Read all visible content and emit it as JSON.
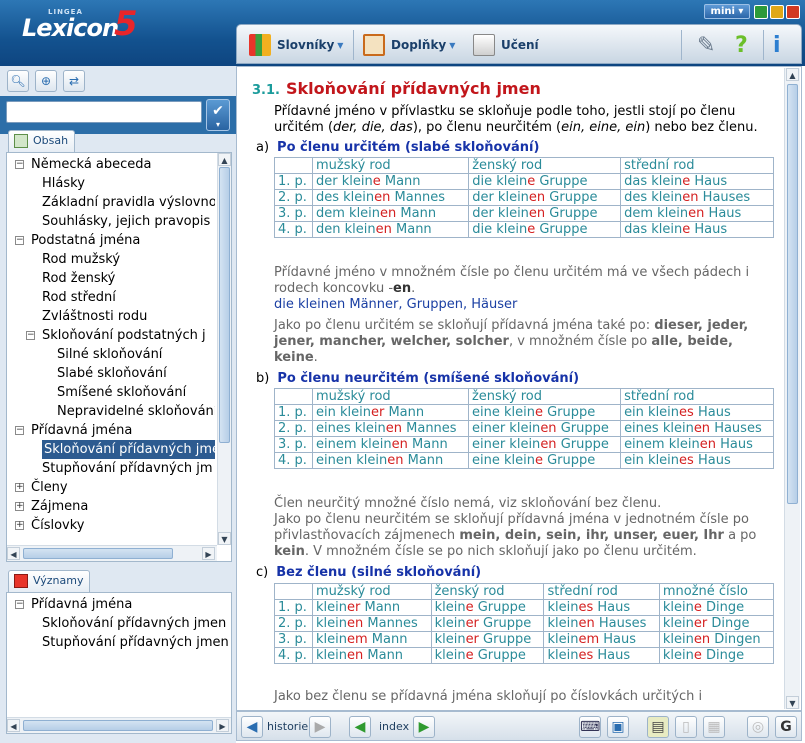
{
  "app": {
    "title": "Lexicon",
    "version": "5",
    "brand": "LINGEA"
  },
  "window": {
    "mini_label": "mini"
  },
  "menu": [
    {
      "label": "Slovníky"
    },
    {
      "label": "Doplňky"
    },
    {
      "label": "Učení"
    }
  ],
  "search": {
    "value": ""
  },
  "tabs": {
    "obsah": "Obsah",
    "vyznamy": "Významy"
  },
  "tree": [
    {
      "label": "Německá abeceda",
      "level": 0,
      "exp": "-"
    },
    {
      "label": "Hlásky",
      "level": 1
    },
    {
      "label": "Základní pravidla výslovno",
      "level": 1
    },
    {
      "label": "Souhlásky, jejich pravopis",
      "level": 1
    },
    {
      "label": "Podstatná jména",
      "level": 0,
      "exp": "-"
    },
    {
      "label": "Rod mužský",
      "level": 1
    },
    {
      "label": "Rod ženský",
      "level": 1
    },
    {
      "label": "Rod střední",
      "level": 1
    },
    {
      "label": "Zvláštnosti rodu",
      "level": 1
    },
    {
      "label": "Skloňování podstatných j",
      "level": 1,
      "exp": "-"
    },
    {
      "label": "Silné skloňování",
      "level": 2
    },
    {
      "label": "Slabé skloňování",
      "level": 2
    },
    {
      "label": "Smíšené skloňování",
      "level": 2
    },
    {
      "label": "Nepravidelné skloňování",
      "level": 2
    },
    {
      "label": "Přídavná jména",
      "level": 0,
      "exp": "-"
    },
    {
      "label": "Skloňování přídavných jme",
      "level": 1,
      "sel": true
    },
    {
      "label": "Stupňování přídavných jm",
      "level": 1
    },
    {
      "label": "Členy",
      "level": 0,
      "exp": "+"
    },
    {
      "label": "Zájmena",
      "level": 0,
      "exp": "+"
    },
    {
      "label": "Číslovky",
      "level": 0,
      "exp": "+"
    }
  ],
  "meanings": [
    {
      "label": "Přídavná jména",
      "level": 0,
      "exp": "-"
    },
    {
      "label": "Skloňování přídavných jmen",
      "level": 1
    },
    {
      "label": "Stupňování přídavných jmen",
      "level": 1
    }
  ],
  "article": {
    "num": "3.1.",
    "title": "Skloňování přídavných jmen",
    "intro": [
      "Přídavné jméno v přívlastku se skloňuje podle toho, jestli stojí po členu",
      "určitém (",
      "der, die, das",
      "), po členu neurčitém (",
      "ein, eine, ein",
      ") nebo bez členu."
    ],
    "sec_a": {
      "letter": "a)",
      "title": "Po členu určitém (slabé skloňování)"
    },
    "table_a": {
      "headers": [
        "mužský rod",
        "ženský rod",
        "střední rod"
      ],
      "rows": [
        [
          "1. p.",
          [
            "der klein",
            "e",
            " Mann"
          ],
          [
            "die klein",
            "e",
            " Gruppe"
          ],
          [
            "das klein",
            "e",
            " Haus"
          ]
        ],
        [
          "2. p.",
          [
            "des klein",
            "en",
            " Mannes"
          ],
          [
            "der klein",
            "en",
            " Gruppe"
          ],
          [
            "des klein",
            "en",
            " Hauses"
          ]
        ],
        [
          "3. p.",
          [
            "dem klein",
            "en",
            " Mann"
          ],
          [
            "der klein",
            "en",
            " Gruppe"
          ],
          [
            "dem klein",
            "en",
            " Haus"
          ]
        ],
        [
          "4. p.",
          [
            "den klein",
            "en",
            " Mann"
          ],
          [
            "die klein",
            "e",
            " Gruppe"
          ],
          [
            "das klein",
            "e",
            " Haus"
          ]
        ]
      ]
    },
    "plural_note": [
      "Přídavné jméno v množném čísle po členu určitém má ve všech pádech i",
      "rodech koncovku -",
      "en",
      "."
    ],
    "plural_ex": "die kleinen Männer, Gruppen, Häuser",
    "like_def": [
      "Jako po členu určitém se skloňují přídavná jména také po: ",
      "dieser, jeder,",
      "jener, mancher, welcher, solcher",
      ", v množném čísle po ",
      "alle, beide,",
      "keine",
      "."
    ],
    "sec_b": {
      "letter": "b)",
      "title": "Po členu neurčitém (smíšené skloňování)"
    },
    "table_b": {
      "headers": [
        "mužský rod",
        "ženský rod",
        "střední rod"
      ],
      "rows": [
        [
          "1. p.",
          [
            "ein klein",
            "er",
            " Mann"
          ],
          [
            "eine klein",
            "e",
            " Gruppe"
          ],
          [
            "ein klein",
            "es",
            " Haus"
          ]
        ],
        [
          "2. p.",
          [
            "eines klein",
            "en",
            " Mannes"
          ],
          [
            "einer klein",
            "en",
            " Gruppe"
          ],
          [
            "eines klein",
            "en",
            " Hauses"
          ]
        ],
        [
          "3. p.",
          [
            "einem klein",
            "en",
            " Mann"
          ],
          [
            "einer klein",
            "en",
            " Gruppe"
          ],
          [
            "einem klein",
            "en",
            " Haus"
          ]
        ],
        [
          "4. p.",
          [
            "einen klein",
            "en",
            " Mann"
          ],
          [
            "eine klein",
            "e",
            " Gruppe"
          ],
          [
            "ein klein",
            "es",
            " Haus"
          ]
        ]
      ]
    },
    "indef_note1": "Člen neurčitý množné číslo nemá, viz skloňování bez členu.",
    "indef_note2": [
      "Jako po členu neurčitém se skloňují přídavná jména v jednotném čísle po",
      "přivlastňovacích zájmenech ",
      "mein, dein, sein, ihr, unser, euer, Ihr",
      " a po",
      "kein",
      ". V množném čísle se po nich skloňují jako po členu určitém."
    ],
    "sec_c": {
      "letter": "c)",
      "title": "Bez členu (silné skloňování)"
    },
    "table_c": {
      "headers": [
        "mužský rod",
        "ženský rod",
        "střední rod",
        "množné číslo"
      ],
      "rows": [
        [
          "1. p.",
          [
            "klein",
            "er",
            " Mann"
          ],
          [
            "klein",
            "e",
            " Gruppe"
          ],
          [
            "klein",
            "es",
            " Haus"
          ],
          [
            "klein",
            "e",
            " Dinge"
          ]
        ],
        [
          "2. p.",
          [
            "klein",
            "en",
            " Mannes"
          ],
          [
            "klein",
            "er",
            " Gruppe"
          ],
          [
            "klein",
            "en",
            " Hauses"
          ],
          [
            "klein",
            "er",
            " Dinge"
          ]
        ],
        [
          "3. p.",
          [
            "klein",
            "em",
            " Mann"
          ],
          [
            "klein",
            "er",
            " Gruppe"
          ],
          [
            "klein",
            "em",
            " Haus"
          ],
          [
            "klein",
            "en",
            " Dingen"
          ]
        ],
        [
          "4. p.",
          [
            "klein",
            "en",
            " Mann"
          ],
          [
            "klein",
            "e",
            " Gruppe"
          ],
          [
            "klein",
            "es",
            " Haus"
          ],
          [
            "klein",
            "e",
            " Dinge"
          ]
        ]
      ]
    },
    "last_line": "Jako bez členu se přídavná jména skloňují po číslovkách určitých i"
  },
  "nav": {
    "history": "historie",
    "index": "index"
  }
}
